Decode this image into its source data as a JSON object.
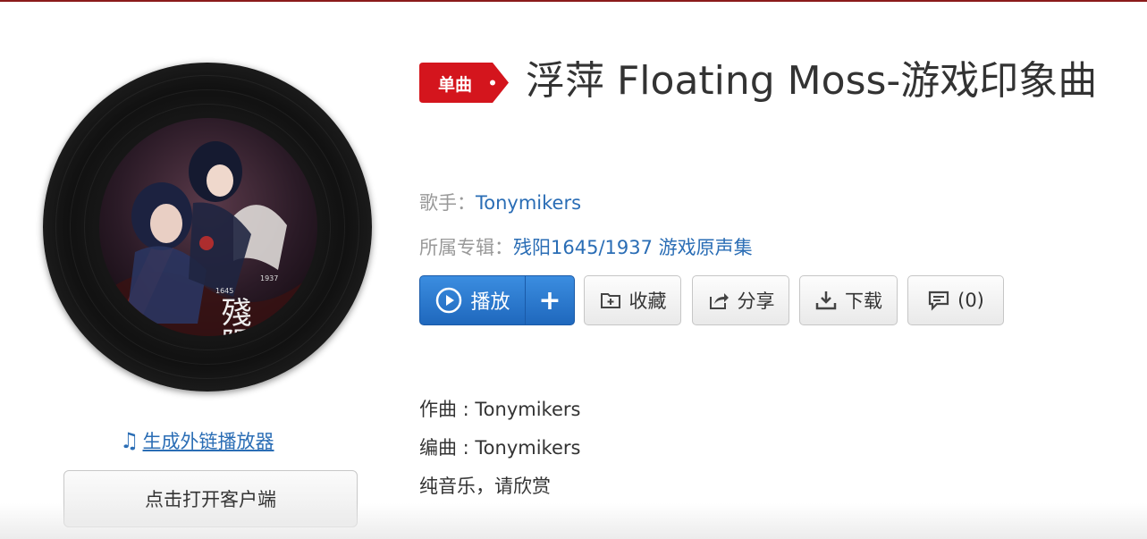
{
  "song": {
    "tag": "单曲",
    "title": "浮萍 Floating Moss-游戏印象曲",
    "singer_label": "歌手：",
    "singer": "Tonymikers",
    "album_label": "所属专辑：",
    "album": "残阳1645/1937 游戏原声集"
  },
  "cover": {
    "art_text": "殘陽",
    "art_year_left": "1645",
    "art_year_right": "1937"
  },
  "left": {
    "player_link": "生成外链播放器",
    "open_client": "点击打开客户端"
  },
  "actions": {
    "play": "播放",
    "add": "+",
    "collect": "收藏",
    "share": "分享",
    "download": "下载",
    "comment": "(0)"
  },
  "description": {
    "line1": "作曲 : Tonymikers",
    "line2": "编曲 : Tonymikers",
    "line3": "纯音乐，请欣赏"
  },
  "colors": {
    "accent_blue": "#2a6db5",
    "tag_red": "#d4151d",
    "play_blue": "#2f7fd6"
  }
}
